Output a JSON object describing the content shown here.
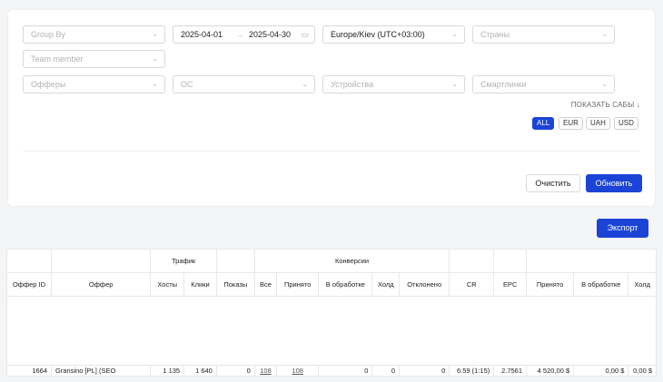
{
  "filters": {
    "group_by": "Group By",
    "date_from": "2025-04-01",
    "date_arrow": "→",
    "date_to": "2025-04-30",
    "timezone": "Europe/Kiev (UTC+03:00)",
    "countries": "Страны",
    "team_member": "Team member",
    "offers": "Офферы",
    "os": "ОС",
    "devices": "Устройства",
    "smartlinks": "Смартлинки"
  },
  "show_subs": "ПОКАЗАТЬ САБЫ ↓",
  "currencies": [
    "ALL",
    "EUR",
    "UAH",
    "USD"
  ],
  "active_currency": "ALL",
  "buttons": {
    "clear": "Очистить",
    "refresh": "Обновить",
    "export": "Экспорт"
  },
  "table": {
    "groups": {
      "traffic": "Трафик",
      "conversions": "Конверсии"
    },
    "columns": [
      "Оффер ID",
      "Оффер",
      "Хосты",
      "Клики",
      "Показы",
      "Все",
      "Принято",
      "В обработке",
      "Холд",
      "Отклонено",
      "CR",
      "EPC",
      "Принято",
      "В обработке",
      "Холд"
    ],
    "rows": [
      [
        "1664",
        "Gransino [PL] (SEO",
        "1 135",
        "1 640",
        "0",
        "108",
        "108",
        "0",
        "0",
        "0",
        "6.59 (1:15)",
        "2.7561",
        "4 520,00 $",
        "0,00 $",
        "0,00 $"
      ]
    ]
  },
  "colors": {
    "accent": "#1b44d6"
  }
}
